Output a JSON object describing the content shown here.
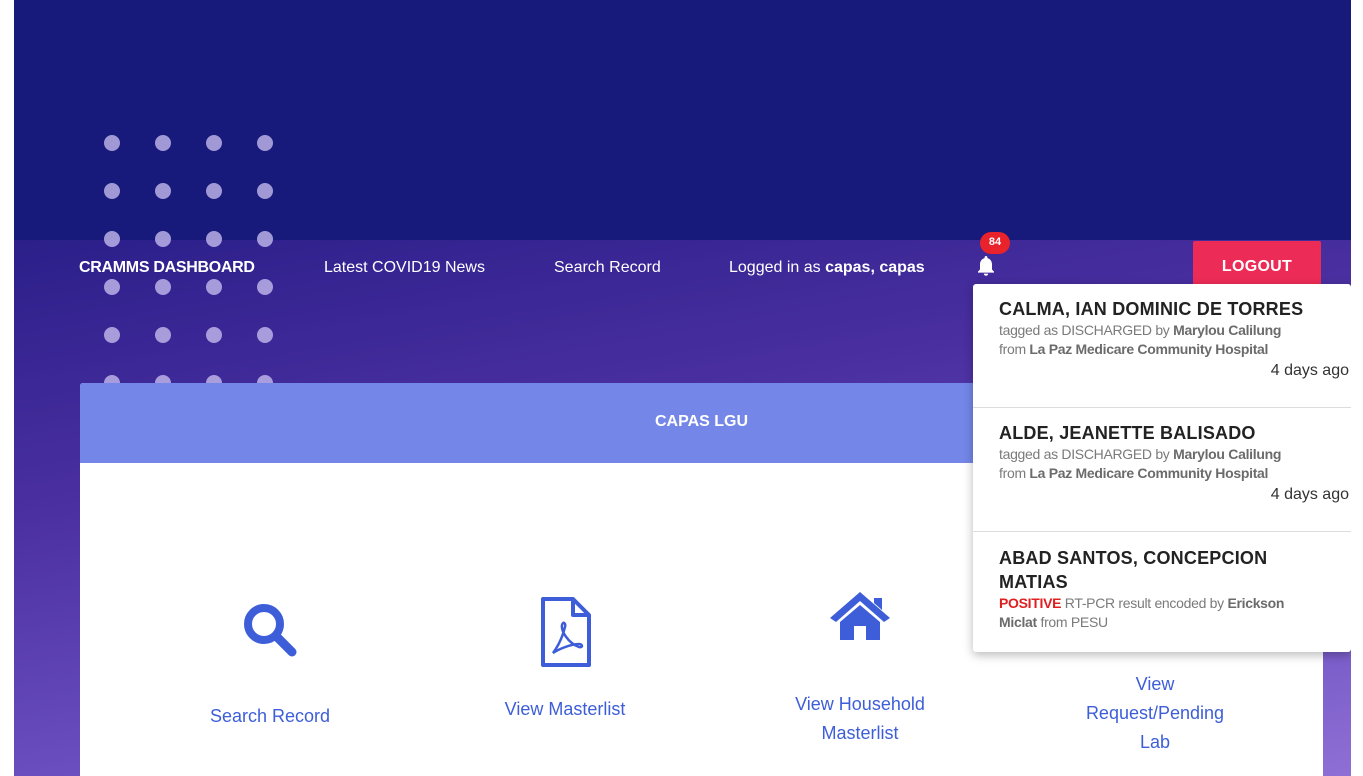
{
  "nav": {
    "brand": "CRAMMS DASHBOARD",
    "news": "Latest COVID19 News",
    "search": "Search Record",
    "logged_prefix": "Logged in as ",
    "logged_user": "capas, capas",
    "badge_count": "84",
    "logout": "LOGOUT"
  },
  "card": {
    "title": "CAPAS LGU",
    "tiles": [
      {
        "icon": "search-icon",
        "label": "Search Record"
      },
      {
        "icon": "pdf-document-icon",
        "label": "View Masterlist"
      },
      {
        "icon": "home-icon",
        "label_line1": "View Household",
        "label_line2": "Masterlist"
      },
      {
        "icon": "lab-icon",
        "label_line1": "View",
        "label_line2": "Request/Pending",
        "label_line3": "Lab"
      }
    ]
  },
  "notifications": [
    {
      "name": "CALMA, IAN DOMINIC DE TORRES",
      "line1_prefix": "tagged as DISCHARGED by ",
      "line1_person": "Marylou Calilung",
      "line2_prefix": "from ",
      "line2_place": "La Paz Medicare Community Hospital",
      "time": "4 days ago"
    },
    {
      "name": "ALDE, JEANETTE BALISADO",
      "line1_prefix": "tagged as DISCHARGED by ",
      "line1_person": "Marylou Calilung",
      "line2_prefix": "from ",
      "line2_place": "La Paz Medicare Community Hospital",
      "time": "4 days ago"
    },
    {
      "name_line1": "ABAD SANTOS, CONCEPCION",
      "name_line2": "MATIAS",
      "status": "POSITIVE",
      "line1_text": " RT-PCR result encoded by ",
      "line1_person": "Erickson",
      "line2_person": "Miclat",
      "line2_text": " from PESU"
    }
  ],
  "colors": {
    "background_top": "#171a7a",
    "card_header": "#7487e8",
    "accent_blue": "#3d5ed8",
    "logout": "#ec2c57",
    "badge": "#e8232b",
    "positive": "#e02020"
  }
}
